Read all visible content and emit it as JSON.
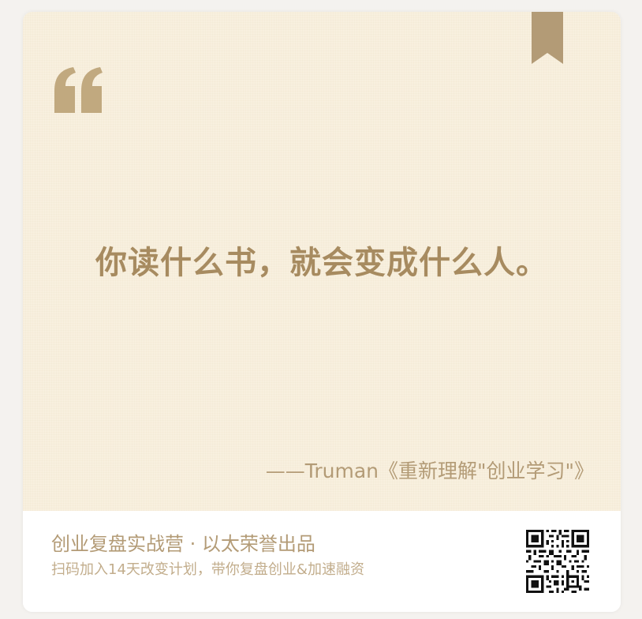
{
  "quote": {
    "text": "你读什么书，就会变成什么人。",
    "attribution": "——Truman《重新理解\"创业学习\"》"
  },
  "footer": {
    "title": "创业复盘实战营 · 以太荣誉出品",
    "subtitle": "扫码加入14天改变计划，带你复盘创业&加速融资"
  },
  "icons": {
    "quote_mark": "open-quote-icon",
    "bookmark": "bookmark-ribbon-icon",
    "qr": "qr-code"
  },
  "colors": {
    "panel_background": "#f8f0df",
    "quote_text": "#a78b60",
    "accent": "#b39b76",
    "footer_background": "#ffffff"
  }
}
